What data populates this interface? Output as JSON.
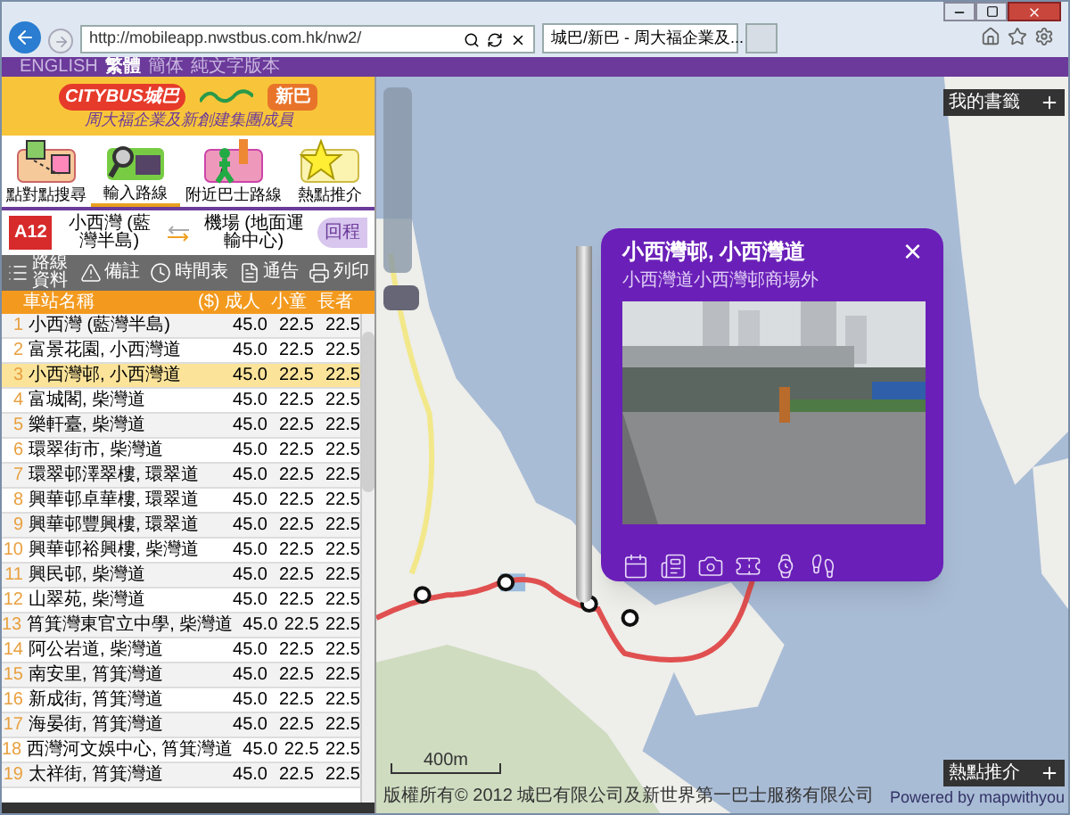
{
  "browser": {
    "address": "http://mobileapp.nwstbus.com.hk/nw2/",
    "tabs": [
      {
        "title": "城巴/新巴 - 周大福企業及...",
        "selected": true
      }
    ]
  },
  "language_bar": [
    {
      "label": "ENGLISH",
      "selected": false
    },
    {
      "label": "繁體",
      "selected": true
    },
    {
      "label": "簡体",
      "selected": false
    },
    {
      "label": "純文字版本",
      "selected": false
    }
  ],
  "logo": {
    "citybus": "CITYBUS城巴",
    "nwfb": "新巴",
    "tagline": "周大福企業及新創建集團成員"
  },
  "nav": [
    {
      "label": "點對點搜尋",
      "kind": "map",
      "selected": false
    },
    {
      "label": "輸入路線",
      "kind": "search",
      "selected": true
    },
    {
      "label": "附近巴士路線",
      "kind": "walk",
      "selected": false
    },
    {
      "label": "熱點推介",
      "kind": "star",
      "selected": false
    }
  ],
  "route": {
    "number": "A12",
    "origin": "小西灣 (藍灣半島)",
    "destination": "機場 (地面運輸中心)",
    "return_button": "回程"
  },
  "toolbar": [
    {
      "label": "路線資料",
      "kind": "list"
    },
    {
      "label": "備註",
      "kind": "warning"
    },
    {
      "label": "時間表",
      "kind": "clock"
    },
    {
      "label": "通告",
      "kind": "notice"
    },
    {
      "label": "列印",
      "kind": "print"
    }
  ],
  "table": {
    "columns": [
      "車站名稱",
      "($) 成人",
      "小童",
      "長者"
    ],
    "rows": [
      {
        "index": "1",
        "name": "小西灣 (藍灣半島)",
        "adult": "45.0",
        "child": "22.5",
        "senior": "22.5",
        "selected": false
      },
      {
        "index": "2",
        "name": "富景花園, 小西灣道",
        "adult": "45.0",
        "child": "22.5",
        "senior": "22.5",
        "selected": false
      },
      {
        "index": "3",
        "name": "小西灣邨, 小西灣道",
        "adult": "45.0",
        "child": "22.5",
        "senior": "22.5",
        "selected": true
      },
      {
        "index": "4",
        "name": "富城閣, 柴灣道",
        "adult": "45.0",
        "child": "22.5",
        "senior": "22.5",
        "selected": false
      },
      {
        "index": "5",
        "name": "樂軒臺, 柴灣道",
        "adult": "45.0",
        "child": "22.5",
        "senior": "22.5",
        "selected": false
      },
      {
        "index": "6",
        "name": "環翠街市, 柴灣道",
        "adult": "45.0",
        "child": "22.5",
        "senior": "22.5",
        "selected": false
      },
      {
        "index": "7",
        "name": "環翠邨澤翠樓, 環翠道",
        "adult": "45.0",
        "child": "22.5",
        "senior": "22.5",
        "selected": false
      },
      {
        "index": "8",
        "name": "興華邨卓華樓, 環翠道",
        "adult": "45.0",
        "child": "22.5",
        "senior": "22.5",
        "selected": false
      },
      {
        "index": "9",
        "name": "興華邨豐興樓, 環翠道",
        "adult": "45.0",
        "child": "22.5",
        "senior": "22.5",
        "selected": false
      },
      {
        "index": "10",
        "name": "興華邨裕興樓, 柴灣道",
        "adult": "45.0",
        "child": "22.5",
        "senior": "22.5",
        "selected": false
      },
      {
        "index": "11",
        "name": "興民邨, 柴灣道",
        "adult": "45.0",
        "child": "22.5",
        "senior": "22.5",
        "selected": false
      },
      {
        "index": "12",
        "name": "山翠苑, 柴灣道",
        "adult": "45.0",
        "child": "22.5",
        "senior": "22.5",
        "selected": false
      },
      {
        "index": "13",
        "name": "筲箕灣東官立中學, 柴灣道",
        "adult": "45.0",
        "child": "22.5",
        "senior": "22.5",
        "selected": false
      },
      {
        "index": "14",
        "name": "阿公岩道, 柴灣道",
        "adult": "45.0",
        "child": "22.5",
        "senior": "22.5",
        "selected": false
      },
      {
        "index": "15",
        "name": "南安里, 筲箕灣道",
        "adult": "45.0",
        "child": "22.5",
        "senior": "22.5",
        "selected": false
      },
      {
        "index": "16",
        "name": "新成街, 筲箕灣道",
        "adult": "45.0",
        "child": "22.5",
        "senior": "22.5",
        "selected": false
      },
      {
        "index": "17",
        "name": "海晏街, 筲箕灣道",
        "adult": "45.0",
        "child": "22.5",
        "senior": "22.5",
        "selected": false
      },
      {
        "index": "18",
        "name": "西灣河文娛中心, 筲箕灣道",
        "adult": "45.0",
        "child": "22.5",
        "senior": "22.5",
        "selected": false
      },
      {
        "index": "19",
        "name": "太祥街, 筲箕灣道",
        "adult": "45.0",
        "child": "22.5",
        "senior": "22.5",
        "selected": false
      }
    ]
  },
  "map": {
    "bookmarks_button": "我的書籤",
    "hotspot_button": "熱點推介",
    "scale": "400m",
    "copyright": "版權所有© 2012 城巴有限公司及新世界第一巴士服務有限公司",
    "powered_by": "Powered by mapwithyou",
    "popup": {
      "title": "小西灣邨, 小西灣道",
      "subtitle": "小西灣道小西灣邨商場外",
      "close": "×"
    }
  }
}
